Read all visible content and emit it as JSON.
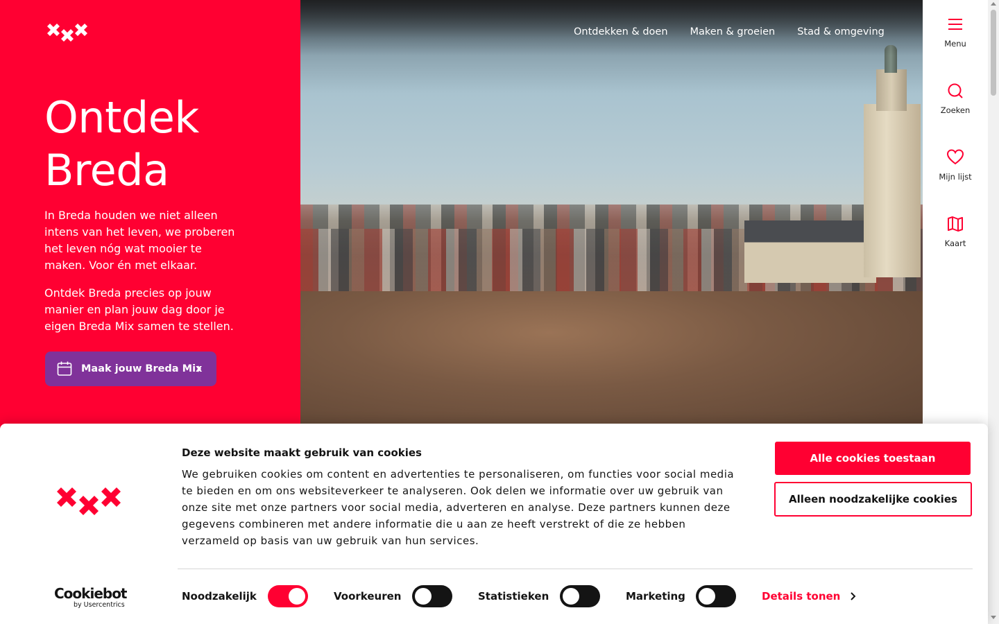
{
  "site": {
    "nav": [
      {
        "label": "Ontdekken & doen"
      },
      {
        "label": "Maken & groeien"
      },
      {
        "label": "Stad & omgeving"
      }
    ]
  },
  "hero": {
    "title_line1": "Ontdek",
    "title_line2": "Breda",
    "paragraph1": "In Breda houden we niet alleen intens van het leven, we proberen het leven nóg wat mooier te maken. Voor én met elkaar.",
    "paragraph2": "Ontdek Breda precies op jouw manier en plan jouw dag door je eigen Breda Mix samen te stellen.",
    "cta_label": "Maak jouw Breda Mix"
  },
  "side_rail": {
    "items": [
      {
        "label": "Menu",
        "icon": "menu-icon"
      },
      {
        "label": "Zoeken",
        "icon": "search-icon"
      },
      {
        "label": "Mijn lijst",
        "icon": "heart-icon"
      },
      {
        "label": "Kaart",
        "icon": "map-icon"
      }
    ]
  },
  "cookie_banner": {
    "title": "Deze website maakt gebruik van cookies",
    "body": "We gebruiken cookies om content en advertenties te personaliseren, om functies voor social media te bieden en om ons websiteverkeer te analyseren. Ook delen we informatie over uw gebruik van onze site met onze partners voor social media, adverteren en analyse. Deze partners kunnen deze gegevens combineren met andere informatie die u aan ze heeft verstrekt of die ze hebben verzameld op basis van uw gebruik van hun services.",
    "allow_all_label": "Alle cookies toestaan",
    "necessary_only_label": "Alleen noodzakelijke cookies",
    "brand_name": "Cookiebot",
    "brand_sub": "by Usercentrics",
    "consents": [
      {
        "label": "Noodzakelijk",
        "checked": true
      },
      {
        "label": "Voorkeuren",
        "checked": false
      },
      {
        "label": "Statistieken",
        "checked": false
      },
      {
        "label": "Marketing",
        "checked": false
      }
    ],
    "details_label": "Details tonen"
  },
  "colors": {
    "brand_red": "#ff0032",
    "cta_purple": "#80329a",
    "text_dark": "#141414"
  }
}
